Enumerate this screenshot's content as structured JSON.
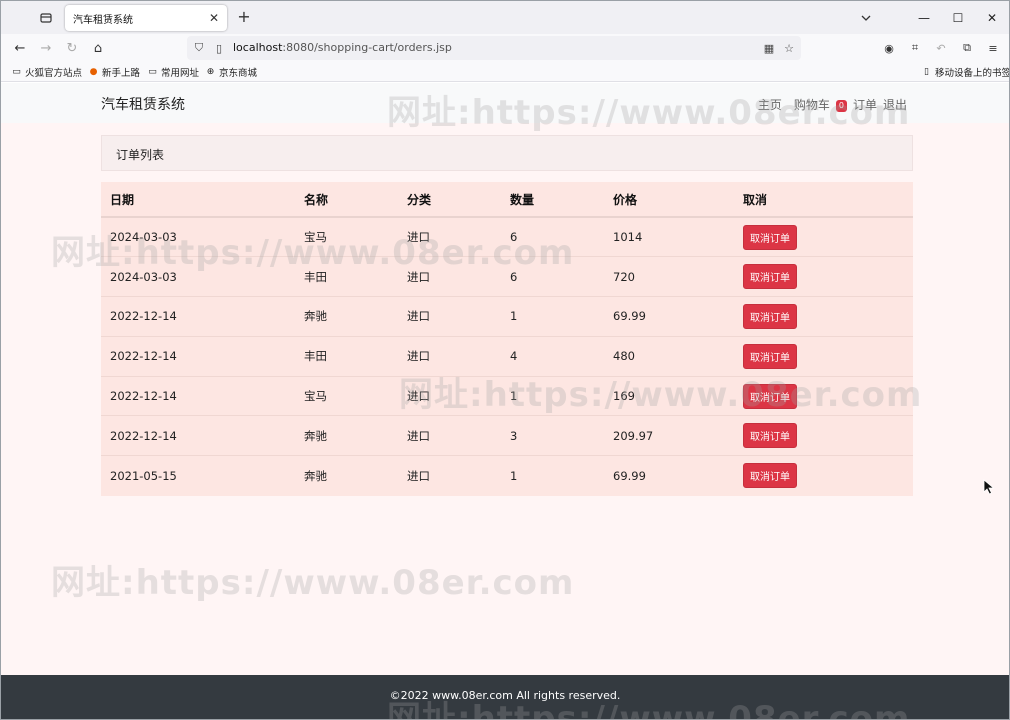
{
  "browser": {
    "tab_title": "汽车租赁系统",
    "url_host": "localhost",
    "url_rest": ":8080/shopping-cart/orders.jsp",
    "bookmarks": [
      "火狐官方站点",
      "新手上路",
      "常用网址",
      "京东商城"
    ],
    "mobile_bookmarks": "移动设备上的书签"
  },
  "site": {
    "brand": "汽车租赁系统",
    "nav": {
      "home": "主页",
      "cart": "购物车",
      "cart_count": "0",
      "orders": "订单",
      "logout": "退出"
    },
    "card_title": "订单列表",
    "table": {
      "headers": [
        "日期",
        "名称",
        "分类",
        "数量",
        "价格",
        "取消"
      ],
      "cancel_label": "取消订单",
      "rows": [
        {
          "date": "2024-03-03",
          "name": "宝马",
          "category": "进口",
          "qty": "6",
          "price": "1014"
        },
        {
          "date": "2024-03-03",
          "name": "丰田",
          "category": "进口",
          "qty": "6",
          "price": "720"
        },
        {
          "date": "2022-12-14",
          "name": "奔驰",
          "category": "进口",
          "qty": "1",
          "price": "69.99"
        },
        {
          "date": "2022-12-14",
          "name": "丰田",
          "category": "进口",
          "qty": "4",
          "price": "480"
        },
        {
          "date": "2022-12-14",
          "name": "宝马",
          "category": "进口",
          "qty": "1",
          "price": "169"
        },
        {
          "date": "2022-12-14",
          "name": "奔驰",
          "category": "进口",
          "qty": "3",
          "price": "209.97"
        },
        {
          "date": "2021-05-15",
          "name": "奔驰",
          "category": "进口",
          "qty": "1",
          "price": "69.99"
        }
      ]
    },
    "footer": "©2022 www.08er.com All rights reserved.",
    "watermark": "网址:https://www.08er.com"
  },
  "colors": {
    "danger": "#dc3545",
    "page_bg": "#fff5f5",
    "table_bg": "#fde6e2",
    "footer_bg": "#343a40"
  }
}
